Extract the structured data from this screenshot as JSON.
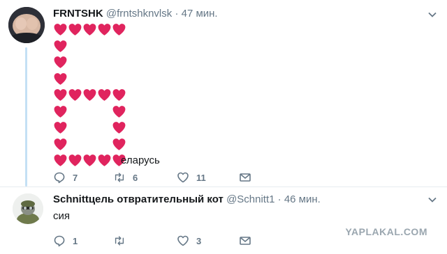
{
  "tweet1": {
    "display_name": "FRNTSHK",
    "handle": "@frntshknvlsk",
    "separator": "·",
    "time": "47 мин.",
    "heart_art": {
      "glyph": "❤",
      "color": "#e0245e",
      "rows": [
        [
          1,
          1,
          1,
          1,
          1
        ],
        [
          1,
          0,
          0,
          0,
          0
        ],
        [
          1,
          0,
          0,
          0,
          0
        ],
        [
          1,
          0,
          0,
          0,
          0
        ],
        [
          1,
          1,
          1,
          1,
          1
        ],
        [
          1,
          0,
          0,
          0,
          1
        ],
        [
          1,
          0,
          0,
          0,
          1
        ],
        [
          1,
          0,
          0,
          0,
          1
        ],
        [
          1,
          1,
          1,
          1,
          1
        ]
      ],
      "suffix_text": "еларусь"
    },
    "actions": {
      "replies": "7",
      "retweets": "6",
      "likes": "11"
    }
  },
  "tweet2": {
    "display_name": "Schnittцель отвратительный кот",
    "handle": "@Schnitt1",
    "separator": "·",
    "time": "46 мин.",
    "text": "сия",
    "actions": {
      "replies": "1",
      "retweets": "",
      "likes": "3"
    }
  },
  "watermark": "YAPLAKAL.COM",
  "icons": {
    "reply": "reply-icon",
    "retweet": "retweet-icon",
    "like": "heart-icon",
    "dm": "envelope-icon",
    "more": "chevron-down-icon"
  },
  "colors": {
    "heart_red": "#e0245e",
    "meta_gray": "#657786",
    "thread_line": "#c4e0f5"
  }
}
